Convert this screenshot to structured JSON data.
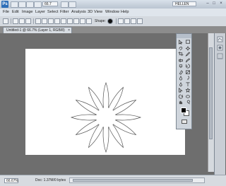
{
  "appbar": {
    "logo": "Ps",
    "zoom": "66.7",
    "workspace": "HELLEN",
    "window_controls": [
      "–",
      "□",
      "×"
    ]
  },
  "menu": [
    "File",
    "Edit",
    "Image",
    "Layer",
    "Select",
    "Filter",
    "Analysis",
    "3D",
    "View",
    "Window",
    "Help"
  ],
  "options_bar": {
    "shape_label": "Shape:"
  },
  "document_tab": {
    "title": "Untitled-1 @ 66.7% (Layer 1, RGB/8)",
    "close": "×"
  },
  "status": {
    "zoom": "66.67%",
    "doc_info": "Doc: 1.37M/0 bytes"
  },
  "colors": {
    "foreground": "#000000",
    "background": "#ffffff",
    "canvas": "#ffffff",
    "pasteboard": "#6e6e6e"
  },
  "tools": [
    "move-tool",
    "marquee-tool",
    "lasso-tool",
    "quick-select-tool",
    "crop-tool",
    "eyedropper-tool",
    "healing-tool",
    "brush-tool",
    "clone-stamp-tool",
    "history-brush-tool",
    "eraser-tool",
    "gradient-tool",
    "blur-tool",
    "dodge-tool",
    "pen-tool",
    "type-tool",
    "path-select-tool",
    "custom-shape-tool",
    "3d-rotate-tool",
    "3d-orbit-tool",
    "hand-tool",
    "zoom-tool"
  ]
}
